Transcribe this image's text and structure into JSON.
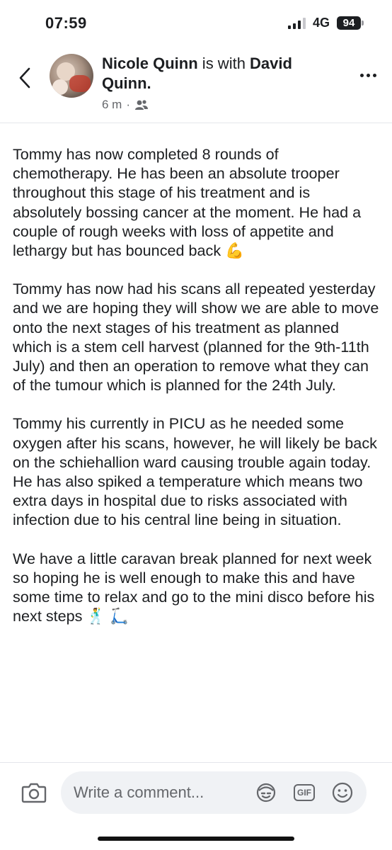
{
  "status_bar": {
    "time": "07:59",
    "network": "4G",
    "battery": "94"
  },
  "header": {
    "author": "Nicole Quinn",
    "connector": " is with ",
    "tagged": "David Quinn.",
    "time_ago": "6 m",
    "separator": "·",
    "audience_icon": "friends-icon"
  },
  "post": {
    "paragraphs": [
      "Tommy has now completed 8 rounds of chemotherapy. He has been an absolute trooper throughout this stage of his treatment and is absolutely bossing cancer at the moment. He had a couple of rough weeks with loss of appetite and lethargy but has bounced back 💪",
      "Tommy has now had his scans all repeated yesterday and we are hoping they will show we are able to move onto the next stages of his treatment as planned which is a stem cell harvest (planned for the 9th-11th July) and then an operation to remove what they can of the tumour which is planned for the 24th July.",
      "Tommy his currently in PICU as he needed some oxygen after his scans, however, he will likely be back on the schiehallion ward causing trouble again today. He has also spiked a temperature which means two extra days in hospital due to risks associated with infection due to his central line being in situation.",
      "We have a little caravan break planned for next week so hoping he is well enough to make this and have some time to relax and go to the mini disco before his next steps 🕺 🛴"
    ]
  },
  "comment_bar": {
    "placeholder": "Write a comment...",
    "gif_label": "GIF"
  },
  "colors": {
    "text": "#1c1e21",
    "muted": "#65676b",
    "input_bg": "#f0f2f5",
    "divider": "#e4e6eb"
  }
}
